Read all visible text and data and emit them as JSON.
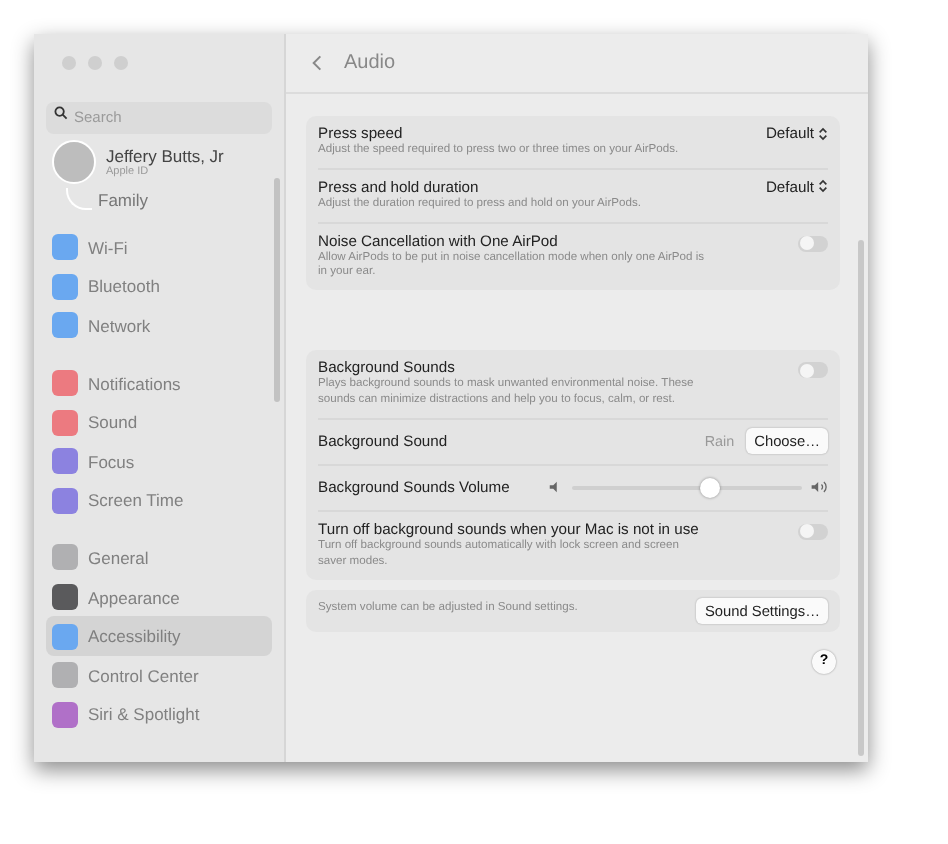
{
  "sidebar": {
    "search": {
      "placeholder": "Search"
    },
    "profile": {
      "name": "Jeffery Butts, Jr",
      "subtitle": "Apple ID"
    },
    "family": "Family",
    "groups": [
      [
        {
          "label": "Wi-Fi",
          "color": "#6aa8f0",
          "selected": false
        },
        {
          "label": "Bluetooth",
          "color": "#6aa8f0",
          "selected": false
        },
        {
          "label": "Network",
          "color": "#6aa8f0",
          "selected": false
        }
      ],
      [
        {
          "label": "Notifications",
          "color": "#ec7a80",
          "selected": false
        },
        {
          "label": "Sound",
          "color": "#ec7a80",
          "selected": false
        },
        {
          "label": "Focus",
          "color": "#8c82e0",
          "selected": false
        },
        {
          "label": "Screen Time",
          "color": "#8c82e0",
          "selected": false
        }
      ],
      [
        {
          "label": "General",
          "color": "#b0b0b2",
          "selected": false
        },
        {
          "label": "Appearance",
          "color": "#5a5a5c",
          "selected": false
        },
        {
          "label": "Accessibility",
          "color": "#6aa8f0",
          "selected": true
        },
        {
          "label": "Control Center",
          "color": "#b0b0b2",
          "selected": false
        },
        {
          "label": "Siri & Spotlight",
          "color": "#b070c8",
          "selected": false
        }
      ]
    ]
  },
  "header": {
    "title": "Audio"
  },
  "cards": [
    [
      {
        "kind": "select",
        "title": "Press speed",
        "description": "Adjust the speed required to press two or three times on your AirPods.",
        "value": "Default"
      },
      {
        "kind": "select",
        "title": "Press and hold duration",
        "description": "Adjust the duration required to press and hold on your AirPods.",
        "value": "Default"
      },
      {
        "kind": "toggle",
        "title": "Noise Cancellation with One AirPod",
        "description": "Allow AirPods to be put in noise cancellation mode when only one AirPod is in your ear.",
        "on": false
      }
    ],
    [
      {
        "kind": "toggle",
        "title": "Background Sounds",
        "description": "Plays background sounds to mask unwanted environmental noise. These sounds can minimize distractions and help you to focus, calm, or rest.",
        "on": false
      },
      {
        "kind": "choose",
        "title": "Background Sound",
        "value": "Rain",
        "button": "Choose…"
      },
      {
        "kind": "slider",
        "title": "Background Sounds Volume",
        "level": 0.6
      },
      {
        "kind": "toggle",
        "title": "Turn off background sounds when your Mac is not in use",
        "description": "Turn off background sounds automatically with lock screen and screen saver modes.",
        "on": false
      }
    ]
  ],
  "footer": {
    "note": "System volume can be adjusted in Sound settings.",
    "button": "Sound Settings…"
  },
  "help": "?"
}
